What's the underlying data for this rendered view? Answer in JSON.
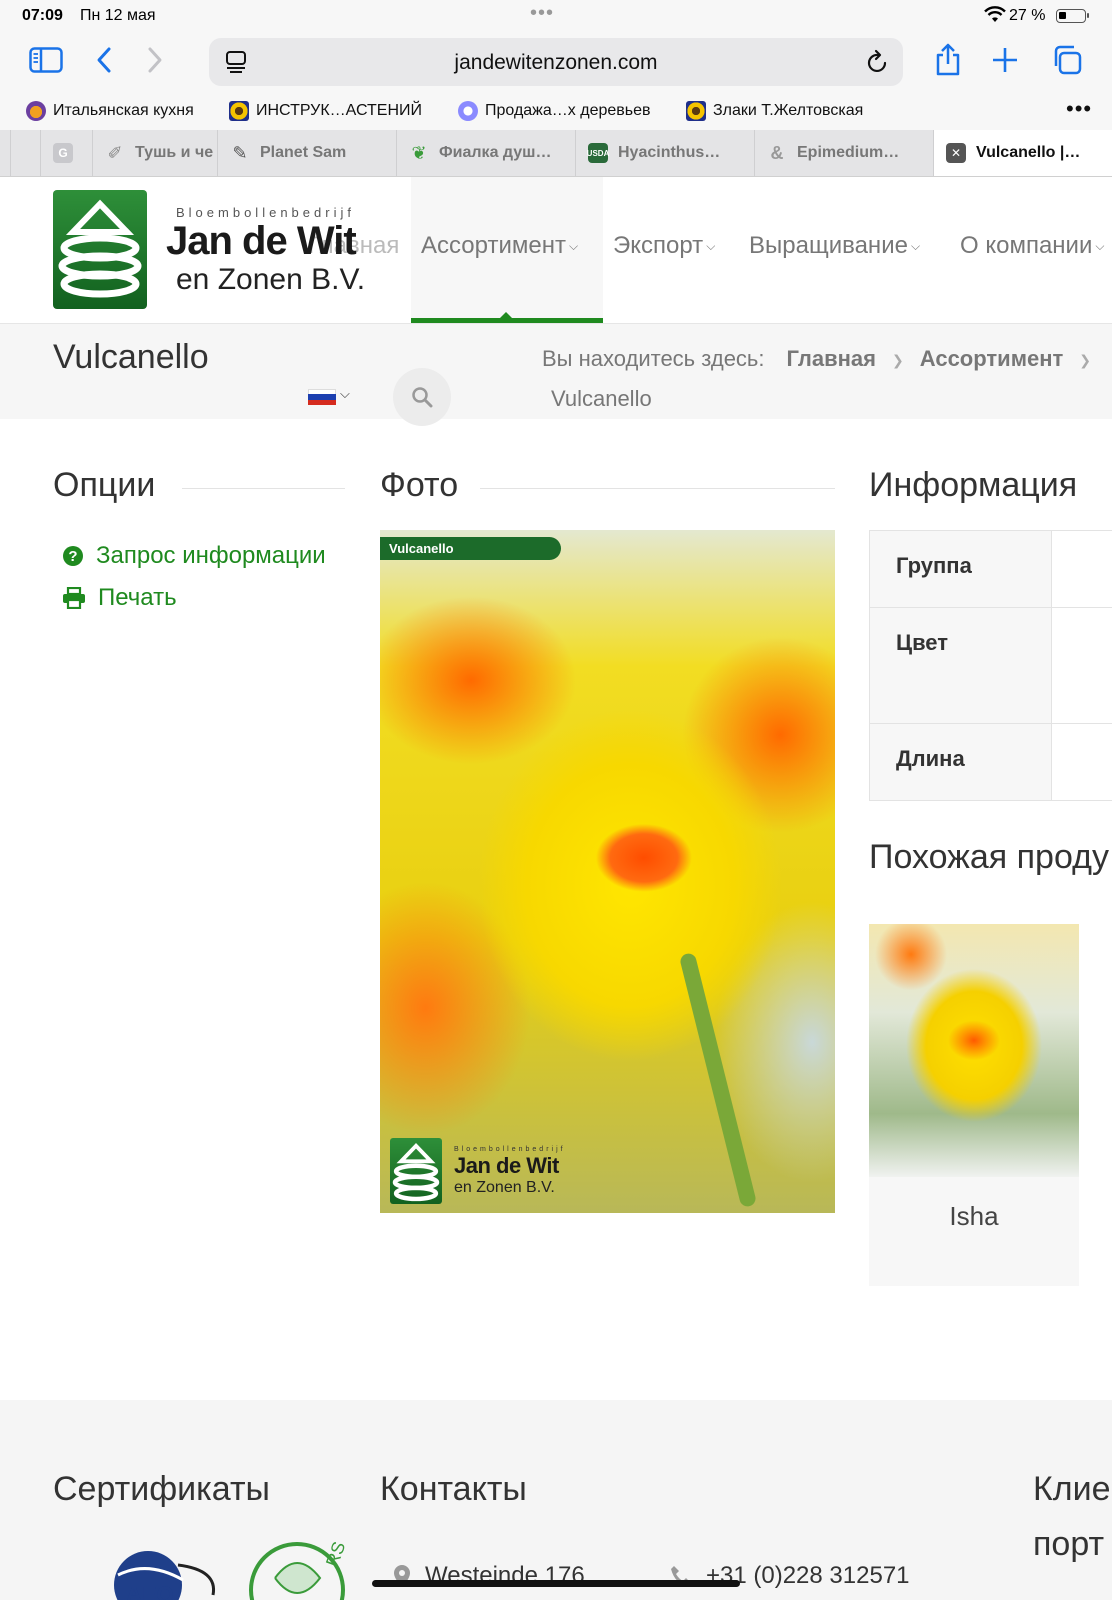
{
  "status_bar": {
    "time": "07:09",
    "date": "Пн 12 мая",
    "battery": "27 %"
  },
  "browser": {
    "url": "jandewitenzonen.com",
    "bookmarks": [
      {
        "label": "Итальянская кухня",
        "icon": "pizza-icon",
        "color": "#6b3fa0"
      },
      {
        "label": "ИНСТРУК…АСТЕНИЙ",
        "icon": "sunflower-icon",
        "color": "#1f2f8a"
      },
      {
        "label": "Продажа…х деревьев",
        "icon": "plant-icon",
        "color": "#8a8aff"
      },
      {
        "label": "Злаки Т.Желтовская",
        "icon": "sunflower-icon",
        "color": "#1f2f8a"
      }
    ],
    "tabs": [
      {
        "label": "",
        "icon": "blank-icon",
        "color": "#cfcfd1"
      },
      {
        "label": "",
        "icon": "google-icon",
        "color": "#c8c8cc"
      },
      {
        "label": "Тушь и че",
        "icon": "brush-icon",
        "color": "#aaaaaa"
      },
      {
        "label": "Planet Sam",
        "icon": "brush-icon",
        "color": "#888888"
      },
      {
        "label": "Фиалка душ…",
        "icon": "leaf-icon",
        "color": "#3a9b3a"
      },
      {
        "label": "Hyacinthus…",
        "icon": "usda-icon",
        "color": "#2a6a3a"
      },
      {
        "label": "Epimedium…",
        "icon": "ampersand-icon",
        "color": "#aaaaaa"
      },
      {
        "label": "Vulcanello |…",
        "icon": "close-tab-icon",
        "color": "#444444"
      }
    ]
  },
  "site": {
    "logo": {
      "small": "Bloembollenbedrijf",
      "big": "Jan de Wit",
      "sub": "en Zonen B.V."
    },
    "nav": [
      {
        "label": "Главная",
        "dropdown": false
      },
      {
        "label": "Ассортимент",
        "dropdown": true
      },
      {
        "label": "Экспорт",
        "dropdown": true
      },
      {
        "label": "Выращивание",
        "dropdown": true
      },
      {
        "label": "О компании",
        "dropdown": true
      }
    ],
    "accent": "#1f8a1f"
  },
  "page": {
    "title": "Vulcanello",
    "breadcrumb": {
      "prefix": "Вы находитесь здесь:",
      "items": [
        "Главная",
        "Ассортимент"
      ],
      "current": "Vulcanello"
    }
  },
  "options": {
    "heading": "Опции",
    "items": [
      {
        "label": "Запрос информации",
        "icon": "question-circle-icon"
      },
      {
        "label": "Печать",
        "icon": "print-icon"
      }
    ]
  },
  "photo": {
    "heading": "Фото",
    "tag": "Vulcanello",
    "watermark": {
      "small": "Bloembollenbedrijf",
      "big": "Jan de Wit",
      "sub": "en Zonen B.V."
    }
  },
  "info": {
    "heading": "Информация",
    "rows": [
      {
        "label": "Группа",
        "value": ""
      },
      {
        "label": "Цвет",
        "value": ""
      },
      {
        "label": "Длина",
        "value": ""
      }
    ]
  },
  "related": {
    "heading": "Похожая проду",
    "items": [
      {
        "name": "Isha"
      }
    ]
  },
  "footer": {
    "certificates": "Сертификаты",
    "contacts": "Контакты",
    "clients_line1": "Клие",
    "clients_line2": "порт",
    "address": "Westeinde 176",
    "phone": "+31 (0)228 312571"
  }
}
